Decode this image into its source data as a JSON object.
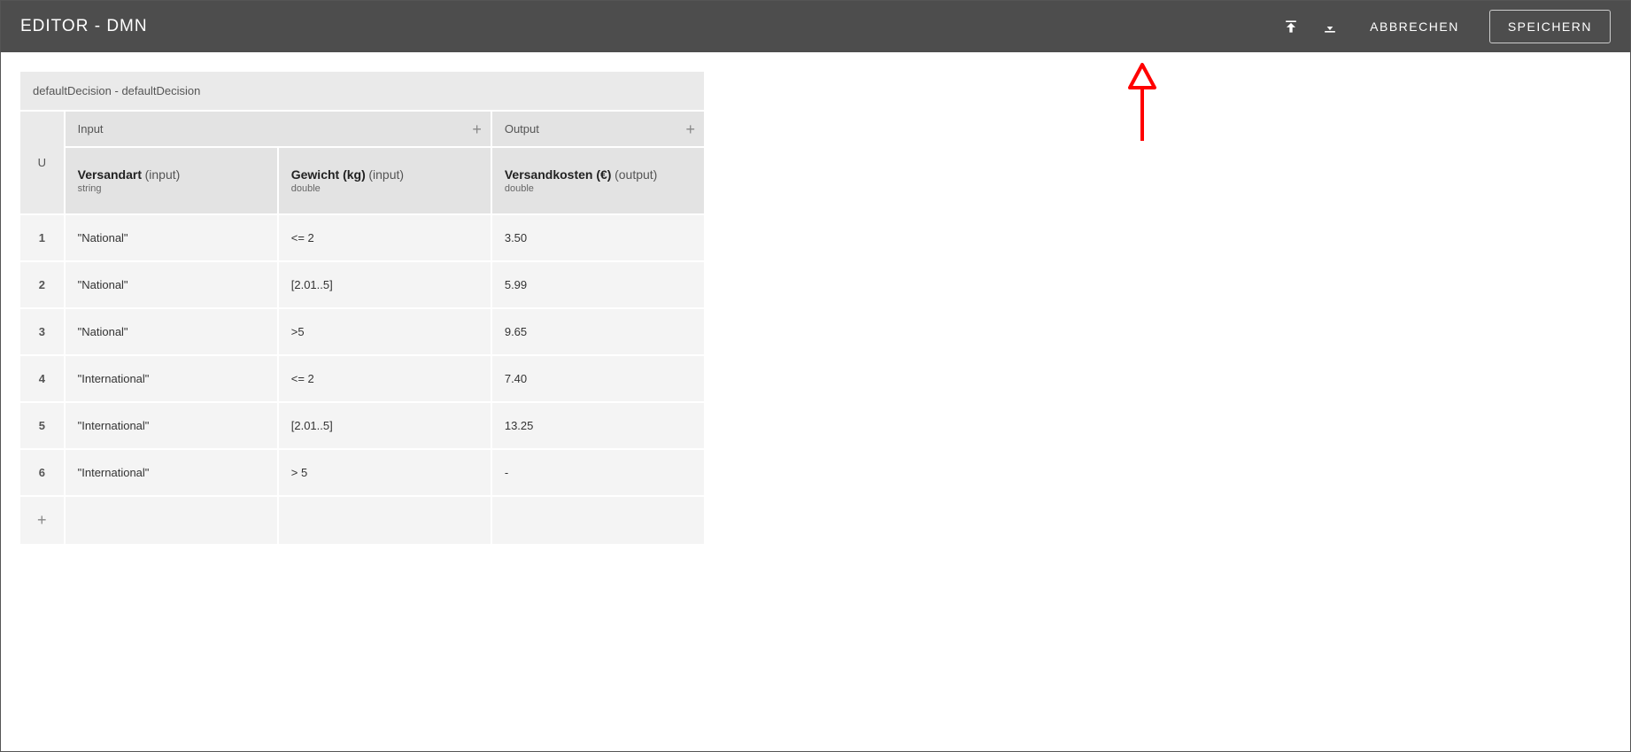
{
  "header": {
    "title": "EDITOR - DMN",
    "cancel_label": "ABBRECHEN",
    "save_label": "SPEICHERN"
  },
  "decision": {
    "title": "defaultDecision - defaultDecision",
    "hit_policy": "U",
    "input_group_label": "Input",
    "output_group_label": "Output",
    "input_columns": [
      {
        "name": "Versandart",
        "kind": "(input)",
        "type": "string"
      },
      {
        "name": "Gewicht (kg)",
        "kind": "(input)",
        "type": "double"
      }
    ],
    "output_columns": [
      {
        "name": "Versandkosten (€)",
        "kind": "(output)",
        "type": "double"
      }
    ],
    "rows": [
      {
        "num": "1",
        "cells": [
          "\"National\"",
          "<= 2",
          "3.50"
        ]
      },
      {
        "num": "2",
        "cells": [
          "\"National\"",
          "[2.01..5]",
          "5.99"
        ]
      },
      {
        "num": "3",
        "cells": [
          "\"National\"",
          ">5",
          "9.65"
        ]
      },
      {
        "num": "4",
        "cells": [
          "\"International\"",
          "<= 2",
          "7.40"
        ]
      },
      {
        "num": "5",
        "cells": [
          "\"International\"",
          "[2.01..5]",
          "13.25"
        ]
      },
      {
        "num": "6",
        "cells": [
          "\"International\"",
          "> 5",
          "-"
        ]
      }
    ]
  }
}
